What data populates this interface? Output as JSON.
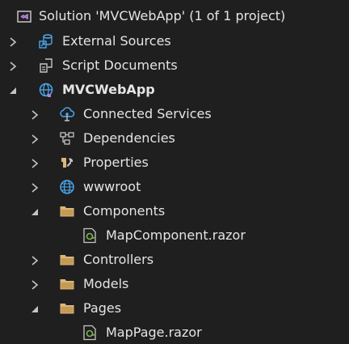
{
  "solution_explorer": {
    "solution": {
      "label": "Solution 'MVCWebApp' (1 of 1 project)"
    },
    "external_sources": {
      "label": "External Sources"
    },
    "script_documents": {
      "label": "Script Documents"
    },
    "project": {
      "label": "MVCWebApp",
      "connected_services": {
        "label": "Connected Services"
      },
      "dependencies": {
        "label": "Dependencies"
      },
      "properties": {
        "label": "Properties"
      },
      "wwwroot": {
        "label": "wwwroot"
      },
      "components": {
        "label": "Components",
        "files": [
          {
            "label": "MapComponent.razor"
          }
        ]
      },
      "controllers": {
        "label": "Controllers"
      },
      "models": {
        "label": "Models"
      },
      "pages": {
        "label": "Pages",
        "files": [
          {
            "label": "MapPage.razor"
          }
        ]
      }
    }
  },
  "colors": {
    "background": "#1f1f1f",
    "text": "#e4e4e4",
    "folder": "#dcb67a",
    "razor": "#7fb24d",
    "globe": "#4aa8f0",
    "vs_purple": "#b180d7"
  },
  "icons": {
    "solution": "visual-studio-solution-icon",
    "external_sources": "external-sources-icon",
    "script_documents": "script-documents-icon",
    "project": "web-project-globe-icon",
    "connected_services": "connected-services-icon",
    "dependencies": "dependencies-icon",
    "properties": "wrench-icon",
    "wwwroot": "globe-icon",
    "folder": "folder-icon",
    "razor_file": "razor-file-icon"
  }
}
